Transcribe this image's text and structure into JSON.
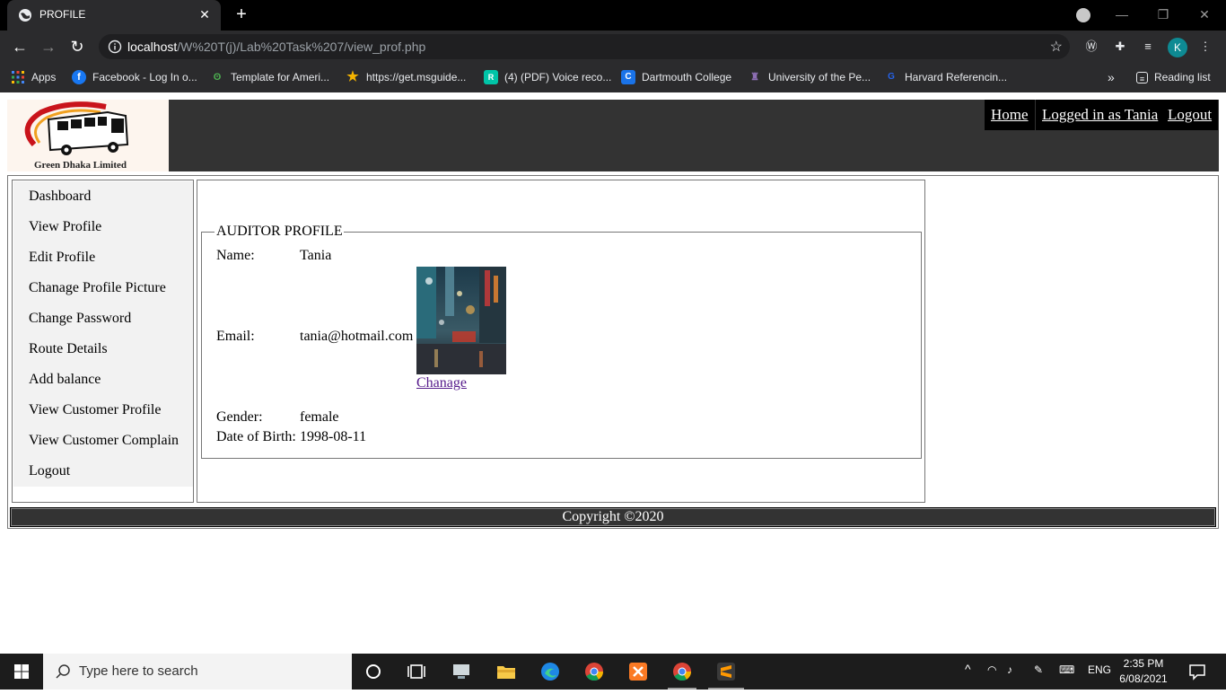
{
  "browser": {
    "tab_title": "PROFILE",
    "url_host": "localhost",
    "url_path": "/W%20T(j)/Lab%20Task%207/view_prof.php",
    "profile_initial": "K",
    "bookmarks": [
      {
        "label": "Apps",
        "icon": "apps-grid-icon",
        "color": "#e44"
      },
      {
        "label": "Facebook - Log In o...",
        "icon": "facebook-icon",
        "color": "#1877f2"
      },
      {
        "label": "Template for Ameri...",
        "icon": "leaf-icon",
        "color": "#4caf50"
      },
      {
        "label": "https://get.msguide...",
        "icon": "star-icon",
        "color": "#f5b400"
      },
      {
        "label": "(4) (PDF) Voice reco...",
        "icon": "researchgate-icon",
        "color": "#00c4a7"
      },
      {
        "label": "Dartmouth College",
        "icon": "dartmouth-icon",
        "color": "#1a73e8"
      },
      {
        "label": "University of the Pe...",
        "icon": "university-icon",
        "color": "#8e6fb5"
      },
      {
        "label": "Harvard Referencin...",
        "icon": "harvard-icon",
        "color": "#2563eb"
      }
    ],
    "reading_list": "Reading list"
  },
  "site": {
    "logo_caption": "Green Dhaka Limited",
    "nav": {
      "home": "Home",
      "logged_in": "Logged in as Tania",
      "logout": "Logout"
    },
    "sidebar": [
      "Dashboard",
      "View Profile",
      "Edit Profile",
      "Chanage Profile Picture",
      "Change Password",
      "Route Details",
      "Add balance",
      "View Customer Profile",
      "View Customer Complain",
      "Logout"
    ],
    "profile": {
      "legend": "AUDITOR PROFILE",
      "name_label": "Name:",
      "name_value": "Tania",
      "email_label": "Email:",
      "email_value": "tania@hotmail.com",
      "change_link": "Chanage",
      "gender_label": "Gender:",
      "gender_value": "female",
      "dob_label": "Date of Birth:",
      "dob_value": "1998-08-11"
    },
    "footer": "Copyright ©2020"
  },
  "taskbar": {
    "search_placeholder": "Type here to search",
    "language": "ENG",
    "time": "2:35 PM",
    "date": "6/08/2021"
  }
}
